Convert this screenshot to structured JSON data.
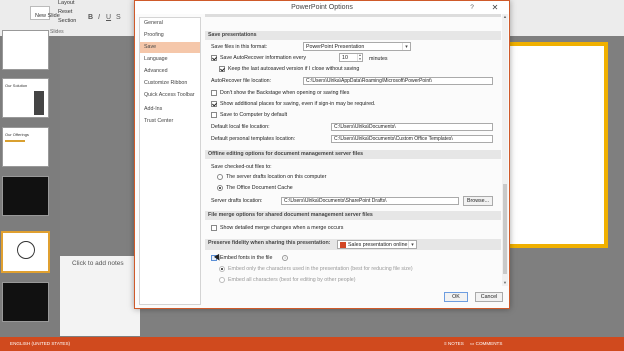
{
  "ribbon": {
    "layout": "Layout",
    "reset": "Reset",
    "section": "Section",
    "new_slide": "New Slide",
    "slides_group": "Slides"
  },
  "thumbnails": {
    "t2": "Our Solution",
    "t3": "Our Offerings"
  },
  "notes_placeholder": "Click to add notes",
  "dialog": {
    "title": "PowerPoint Options",
    "help": "?",
    "close": "✕"
  },
  "nav": [
    "General",
    "Proofing",
    "Save",
    "Language",
    "Advanced",
    "Customize Ribbon",
    "Quick Access Toolbar",
    "Add-Ins",
    "Trust Center"
  ],
  "save_presentations": {
    "header": "Save presentations",
    "format_label": "Save files in this format:",
    "format_value": "PowerPoint Presentation",
    "autorecover_label": "Save AutoRecover information every",
    "autorecover_minutes": "10",
    "minutes_label": "minutes",
    "keep_last_label": "Keep the last autosaved version if I close without saving",
    "autorecover_location_label": "AutoRecover file location:",
    "autorecover_location_value": "C:\\Users\\Ulrika\\AppData\\Roaming\\Microsoft\\PowerPoint\\",
    "dont_show_backstage": "Don't show the Backstage when opening or saving files",
    "show_additional": "Show additional places for saving, even if sign-in may be required.",
    "save_to_computer": "Save to Computer by default",
    "default_local_label": "Default local file location:",
    "default_local_value": "C:\\Users\\Ulrika\\Documents\\",
    "default_templates_label": "Default personal templates location:",
    "default_templates_value": "C:\\Users\\Ulrika\\Documents\\Custom Office Templates\\"
  },
  "offline": {
    "header": "Offline editing options for document management server files",
    "save_checked_out": "Save checked-out files to:",
    "opt_server": "The server drafts location on this computer",
    "opt_cache": "The Office Document Cache",
    "server_drafts_label": "Server drafts location:",
    "server_drafts_value": "C:\\Users\\Ulrika\\Documents\\SharePoint Drafts\\",
    "browse": "Browse..."
  },
  "file_merge": {
    "header": "File merge options for shared document management server files",
    "show_detailed": "Show detailed merge changes when a merge occurs"
  },
  "fidelity": {
    "header": "Preserve fidelity when sharing this presentation:",
    "presentation": "Sales presentation online",
    "embed_fonts": "Embed fonts in the file",
    "embed_only_used": "Embed only the characters used in the presentation (best for reducing file size)",
    "embed_all": "Embed all characters (best for editing by other people)"
  },
  "buttons": {
    "ok": "OK",
    "cancel": "Cancel"
  },
  "status": {
    "language": "ENGLISH (UNITED STATES)",
    "notes": "NOTES",
    "comments": "COMMENTS"
  }
}
